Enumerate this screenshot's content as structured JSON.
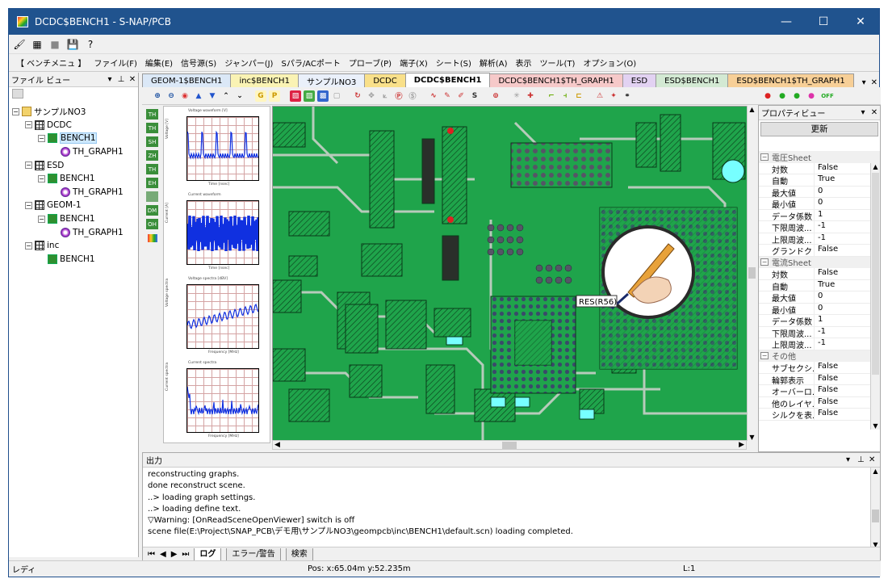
{
  "window": {
    "title": "DCDC$BENCH1 - S-NAP/PCB",
    "min": "—",
    "max": "☐",
    "close": "✕"
  },
  "menu": [
    "【 ベンチメニュ 】",
    "ファイル(F)",
    "編集(E)",
    "信号源(S)",
    "ジャンパー(J)",
    "Sパラ/ACポート",
    "プローブ(P)",
    "端子(X)",
    "シート(S)",
    "解析(A)",
    "表示",
    "ツール(T)",
    "オプション(O)"
  ],
  "left_pane": {
    "title": "ファイル ビュー",
    "tree": [
      {
        "label": "サンプルNO3",
        "level": 0,
        "icon": "folder",
        "expander": "−"
      },
      {
        "label": "DCDC",
        "level": 1,
        "icon": "grid",
        "expander": "−"
      },
      {
        "label": "BENCH1",
        "level": 2,
        "icon": "bench",
        "expander": "−",
        "selected": true
      },
      {
        "label": "TH_GRAPH1",
        "level": 3,
        "icon": "graph",
        "expander": ""
      },
      {
        "label": "ESD",
        "level": 1,
        "icon": "grid",
        "expander": "−"
      },
      {
        "label": "BENCH1",
        "level": 2,
        "icon": "bench",
        "expander": "−"
      },
      {
        "label": "TH_GRAPH1",
        "level": 3,
        "icon": "graph",
        "expander": ""
      },
      {
        "label": "GEOM-1",
        "level": 1,
        "icon": "grid",
        "expander": "−"
      },
      {
        "label": "BENCH1",
        "level": 2,
        "icon": "bench",
        "expander": "−"
      },
      {
        "label": "TH_GRAPH1",
        "level": 3,
        "icon": "graph",
        "expander": ""
      },
      {
        "label": "inc",
        "level": 1,
        "icon": "grid",
        "expander": "−"
      },
      {
        "label": "BENCH1",
        "level": 2,
        "icon": "bench",
        "expander": ""
      }
    ]
  },
  "tabs": [
    {
      "label": "GEOM-1$BENCH1",
      "color": "#dbe8f7",
      "active": false
    },
    {
      "label": "inc$BENCH1",
      "color": "#faf3b4",
      "active": false
    },
    {
      "label": "サンプルNO3",
      "color": "#eaf0fa",
      "active": false
    },
    {
      "label": "DCDC",
      "color": "#f9e08a",
      "active": false
    },
    {
      "label": "DCDC$BENCH1",
      "color": "#ffffff",
      "active": true
    },
    {
      "label": "DCDC$BENCH1$TH_GRAPH1",
      "color": "#f6c9c9",
      "active": false
    },
    {
      "label": "ESD",
      "color": "#e2d2f2",
      "active": false
    },
    {
      "label": "ESD$BENCH1",
      "color": "#d3e9d3",
      "active": false
    },
    {
      "label": "ESD$BENCH1$TH_GRAPH1",
      "color": "#f7cf97",
      "active": false
    }
  ],
  "toolbar2": [
    "G",
    "P",
    "S",
    "OFF"
  ],
  "leftstrip": [
    "TH",
    "TH",
    "SH",
    "ZH",
    "TH",
    "EH",
    "",
    "DM",
    "OH"
  ],
  "graphs": [
    {
      "title": "Voltage waveform [V]",
      "ylabel": "Voltage [V]",
      "xlabel": "Time [nsec]"
    },
    {
      "title": "Current waveform",
      "ylabel": "Current [A]",
      "xlabel": "Time [nsec]"
    },
    {
      "title": "Voltage spectra [dBV]",
      "ylabel": "Voltage spectra",
      "xlabel": "Frequency [MHz]"
    },
    {
      "title": "Current spectra",
      "ylabel": "Current spectra",
      "xlabel": "Frequency [MHz]"
    }
  ],
  "tooltip": "RES(R56)",
  "properties": {
    "title": "プロパティビュー",
    "refresh": "更新",
    "sections": [
      {
        "name": "電圧Sheet",
        "rows": [
          [
            "対数",
            "False"
          ],
          [
            "自動",
            "True"
          ],
          [
            "最大値",
            "0"
          ],
          [
            "最小値",
            "0"
          ],
          [
            "データ係数",
            "1"
          ],
          [
            "下限周波...",
            "-1"
          ],
          [
            "上限周波...",
            "-1"
          ],
          [
            "グランドクリ...",
            "False"
          ]
        ]
      },
      {
        "name": "電流Sheet",
        "rows": [
          [
            "対数",
            "False"
          ],
          [
            "自動",
            "True"
          ],
          [
            "最大値",
            "0"
          ],
          [
            "最小値",
            "0"
          ],
          [
            "データ係数",
            "1"
          ],
          [
            "下限周波...",
            "-1"
          ],
          [
            "上限周波...",
            "-1"
          ]
        ]
      },
      {
        "name": "その他",
        "rows": [
          [
            "サブセクシ...",
            "False"
          ],
          [
            "輪郭表示",
            "False"
          ],
          [
            "オーバーロ...",
            "False"
          ],
          [
            "他のレイヤ...",
            "False"
          ],
          [
            "シルクを表...",
            "False"
          ]
        ]
      }
    ]
  },
  "output": {
    "title": "出力",
    "lines": [
      "reconstructing graphs.",
      "done reconstruct scene.",
      "..> loading graph settings.",
      "..> loading define text.",
      "▽Warning: [OnReadSceneOpenViewer] switch is off",
      "scene file(E:\\Project\\SNAP_PCB\\デモ用\\サンプルNO3\\geompcb\\inc\\BENCH1\\default.scn) loading completed."
    ],
    "tabs": [
      "ログ",
      "エラー/警告",
      "検索"
    ]
  },
  "status": {
    "ready": "レディ",
    "pos": "Pos: x:65.04m y:52.235m",
    "line": "L:1"
  },
  "colors": {
    "pcb_green": "#1fa44b",
    "trace": "#c8d0c8",
    "accent": "#20538e"
  }
}
